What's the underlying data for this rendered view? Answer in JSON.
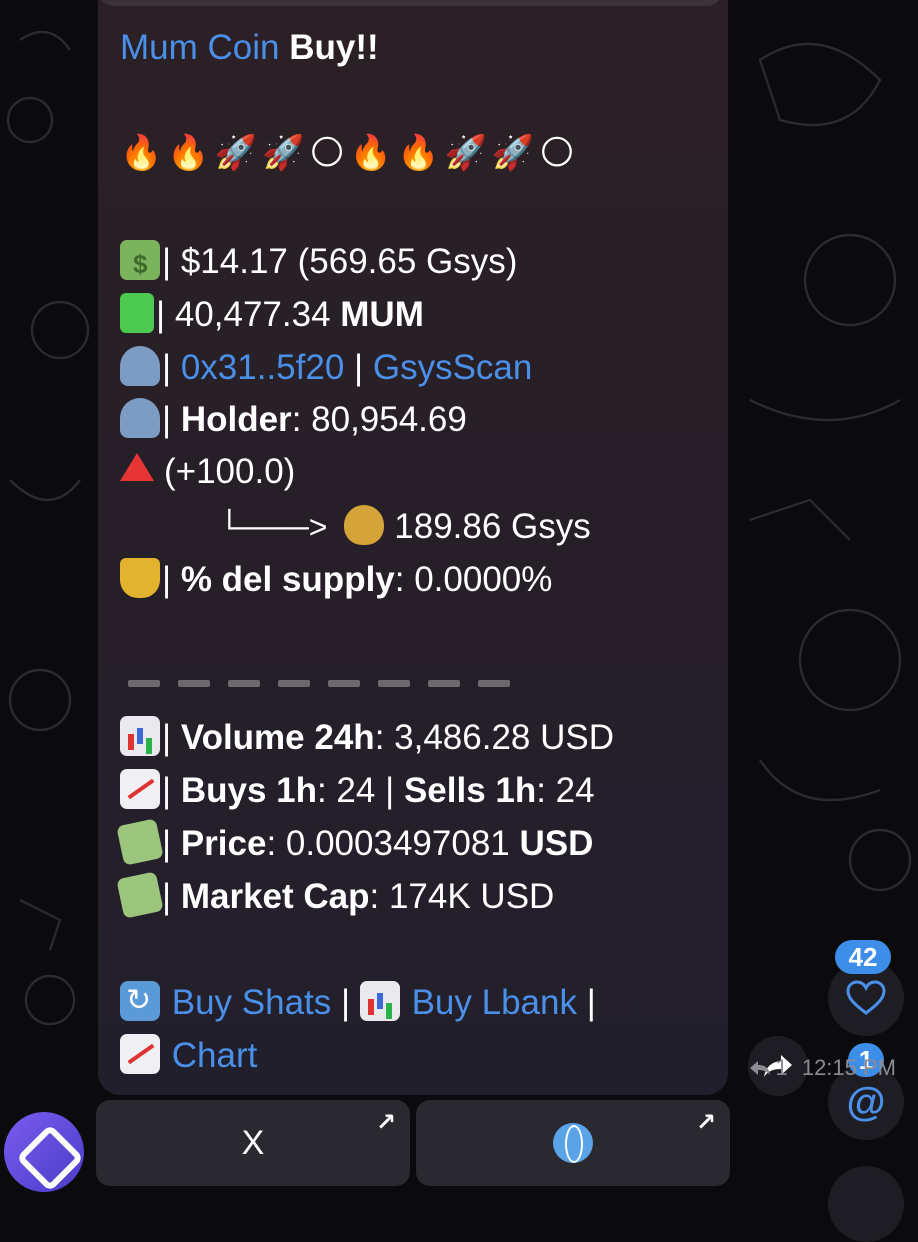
{
  "message": {
    "title_link": "Mum Coin",
    "title_text": "Buy!!",
    "emoji_row": [
      "🔥",
      "🔥",
      "🚀",
      "🚀",
      "🌕",
      "🔥",
      "🔥",
      "🚀",
      "🚀",
      "🌕"
    ],
    "spent": "$14.17 (569.65 Gsys)",
    "amount_value": "40,477.34",
    "amount_token": "MUM",
    "wallet_link": "0x31..5f20",
    "scan_link": "GsysScan",
    "holder_label": "Holder",
    "holder_value": ": 80,954.69",
    "change": "(+100.0)",
    "arrow_line": "└───>",
    "position_value": "189.86 Gsys",
    "supply_label": "% del supply",
    "supply_value": ": 0.0000%",
    "volume_label": "Volume 24h",
    "volume_value": ": 3,486.28 USD",
    "buys_label": "Buys 1h",
    "buys_value": ": 24",
    "sells_label": "Sells 1h",
    "sells_value": ": 24",
    "price_label": "Price",
    "price_value": ": 0.0003497081",
    "price_unit": "USD",
    "mcap_label": "Market Cap",
    "mcap_value": ": 174K USD",
    "link_buy_shats": "Buy Shats",
    "link_buy_lbank": "Buy Lbank",
    "link_chart": "Chart",
    "sep": "|"
  },
  "meta": {
    "reply_count": "1",
    "time": "12:15 PM"
  },
  "keyboard": {
    "button1_label": "X",
    "arrow": "↗"
  },
  "side": {
    "like_count": "42",
    "mention_count": "1"
  },
  "colors": {
    "link": "#4a90e8",
    "badge": "#3d8ee8",
    "bubble": "#261f28"
  }
}
